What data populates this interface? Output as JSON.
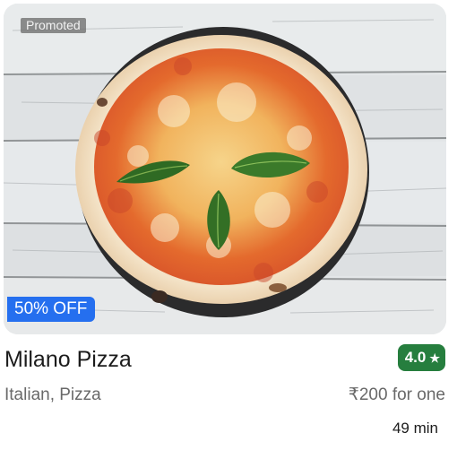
{
  "restaurant": {
    "badge": "Promoted",
    "offer": "50% OFF",
    "name": "Milano Pizza",
    "rating": "4.0",
    "rating_star": "★",
    "rating_color": "#267e3e",
    "cuisines": "Italian, Pizza",
    "price": "₹200 for one",
    "delivery_time": "49 min"
  },
  "colors": {
    "offer_bg": "#256fef",
    "text_primary": "#1c1c1c",
    "text_secondary": "#696969"
  },
  "icons": {
    "rating": "star-icon"
  }
}
